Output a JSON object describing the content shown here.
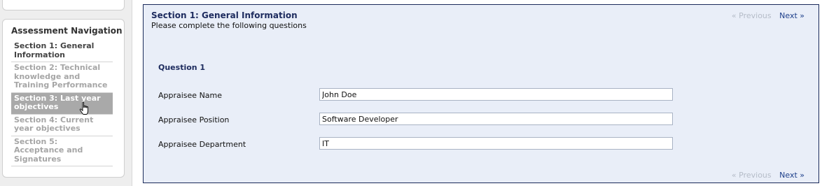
{
  "navigation": {
    "title": "Assessment Navigation",
    "items": [
      {
        "label": "Section 1: General Information",
        "state": "active"
      },
      {
        "label": "Section 2: Technical knowledge and Training Performance",
        "state": "disabled"
      },
      {
        "label": "Section 3: Last year objectives",
        "state": "hover"
      },
      {
        "label": "Section 4: Current year objectives",
        "state": "disabled"
      },
      {
        "label": "Section 5: Acceptance and Signatures",
        "state": "disabled"
      }
    ],
    "cursor_icon": "hand-pointer-icon"
  },
  "section": {
    "title": "Section 1: General Information",
    "subtitle": "Please complete the following questions"
  },
  "pager": {
    "previous_label": "« Previous",
    "next_label": "Next »"
  },
  "question": {
    "title": "Question 1",
    "fields": [
      {
        "label": "Appraisee Name",
        "value": "John Doe"
      },
      {
        "label": "Appraisee Position",
        "value": "Software Developer"
      },
      {
        "label": "Appraisee Department",
        "value": "IT"
      }
    ]
  },
  "colors": {
    "panel_background": "#e9eef8",
    "panel_border": "#1a2a5a",
    "title_color": "#1d2b5e",
    "hover_item_background": "#a9a9a9",
    "link_color": "#1d3f8a",
    "disabled_text": "#a6a6a6"
  }
}
